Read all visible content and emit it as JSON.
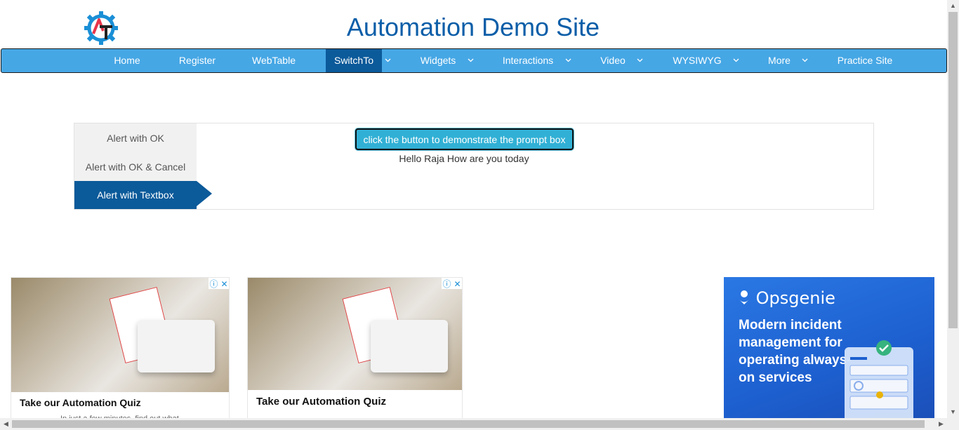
{
  "site": {
    "title": "Automation Demo Site"
  },
  "nav": {
    "items": [
      {
        "label": "Home"
      },
      {
        "label": "Register"
      },
      {
        "label": "WebTable"
      },
      {
        "label": "SwitchTo"
      },
      {
        "label": "Widgets"
      },
      {
        "label": "Interactions"
      },
      {
        "label": "Video"
      },
      {
        "label": "WYSIWYG"
      },
      {
        "label": "More"
      },
      {
        "label": "Practice Site"
      }
    ],
    "active": "SwitchTo"
  },
  "alerts": {
    "tabs": [
      {
        "label": "Alert with OK"
      },
      {
        "label": "Alert with OK & Cancel"
      },
      {
        "label": "Alert with Textbox"
      }
    ],
    "active_tab": "Alert with Textbox",
    "button_label": "click the button to demonstrate the prompt box",
    "result_text": "Hello Raja How are you today"
  },
  "ads": {
    "left": {
      "title": "Take our Automation Quiz",
      "subtitle": "In just a few minutes, find out what"
    },
    "middle": {
      "title": "Take our Automation Quiz"
    },
    "right": {
      "brand": "Opsgenie",
      "headline": "Modern incident management for operating always-on services"
    }
  },
  "colors": {
    "brand_blue": "#0b5ea8",
    "nav_bg": "#46a7e5",
    "nav_active": "#0b5a9a",
    "button_bg": "#31b0d5"
  }
}
